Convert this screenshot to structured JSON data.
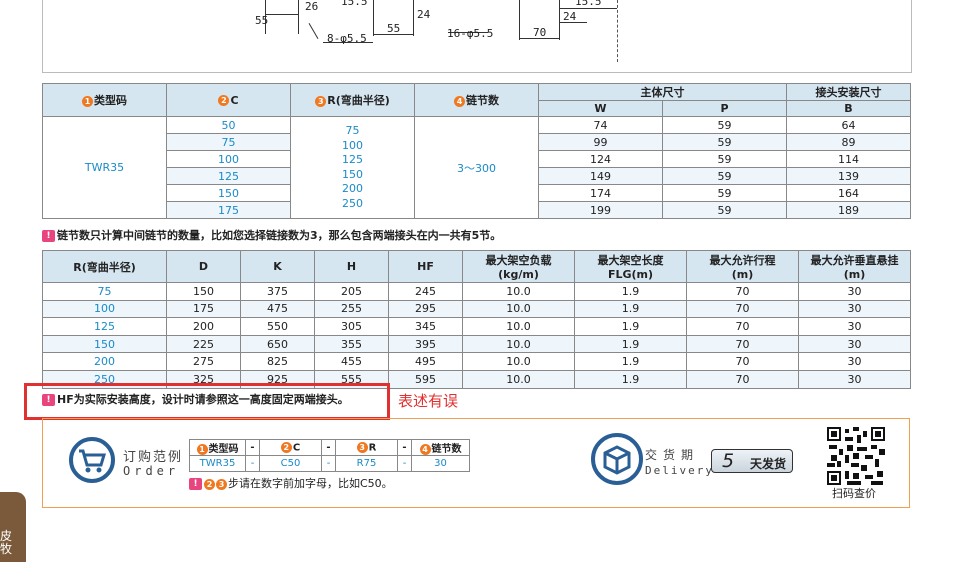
{
  "drawing": {
    "dims": [
      "15.5",
      "26",
      "55",
      "8-φ5.5",
      "24",
      "55",
      "16-φ5.5",
      "70",
      "15.5",
      "24"
    ]
  },
  "table1": {
    "headers": {
      "type_code": "类型码",
      "c": "C",
      "r": "R(弯曲半径)",
      "links": "链节数",
      "body_size": "主体尺寸",
      "joint_size": "接头安装尺寸",
      "w": "W",
      "p": "P",
      "b": "B"
    },
    "badges": [
      "1",
      "2",
      "3",
      "4"
    ],
    "type_code": "TWR35",
    "c_values": [
      "50",
      "75",
      "100",
      "125",
      "150",
      "175"
    ],
    "r_values": [
      "75",
      "100",
      "125",
      "150",
      "200",
      "250"
    ],
    "links": "3～300",
    "rows": [
      {
        "w": "74",
        "p": "59",
        "b": "64"
      },
      {
        "w": "99",
        "p": "59",
        "b": "89"
      },
      {
        "w": "124",
        "p": "59",
        "b": "114"
      },
      {
        "w": "149",
        "p": "59",
        "b": "139"
      },
      {
        "w": "174",
        "p": "59",
        "b": "164"
      },
      {
        "w": "199",
        "p": "59",
        "b": "189"
      }
    ]
  },
  "note1": "链节数只计算中间链节的数量，比如您选择链接数为3，那么包含两端接头在内一共有5节。",
  "table2": {
    "headers": [
      "R(弯曲半径)",
      "D",
      "K",
      "H",
      "HF",
      "最大架空负载",
      "最大架空长度",
      "最大允许行程",
      "最大允许垂直悬挂"
    ],
    "subheaders": [
      "(kg/m)",
      "FLG(m)",
      "(m)",
      "(m)"
    ],
    "rows": [
      [
        "75",
        "150",
        "375",
        "205",
        "245",
        "10.0",
        "1.9",
        "70",
        "30"
      ],
      [
        "100",
        "175",
        "475",
        "255",
        "295",
        "10.0",
        "1.9",
        "70",
        "30"
      ],
      [
        "125",
        "200",
        "550",
        "305",
        "345",
        "10.0",
        "1.9",
        "70",
        "30"
      ],
      [
        "150",
        "225",
        "650",
        "355",
        "395",
        "10.0",
        "1.9",
        "70",
        "30"
      ],
      [
        "200",
        "275",
        "825",
        "455",
        "495",
        "10.0",
        "1.9",
        "70",
        "30"
      ],
      [
        "250",
        "325",
        "925",
        "555",
        "595",
        "10.0",
        "1.9",
        "70",
        "30"
      ]
    ]
  },
  "note2": "HF为实际安装高度，设计时请参照这一高度固定两端接头。",
  "annotation": "表述有误",
  "order": {
    "title_cn": "订购范例",
    "title_en": "Order",
    "headers": [
      "类型码",
      "-",
      "C",
      "-",
      "R",
      "-",
      "链节数"
    ],
    "values": [
      "TWR35",
      "-",
      "C50",
      "-",
      "R75",
      "-",
      "30"
    ],
    "note": "步请在数字前加字母，比如C50。",
    "delivery_cn": "交货期",
    "delivery_en": "Delivery",
    "delivery_days": "5",
    "delivery_label": "天发货",
    "qr_label": "扫码查价"
  },
  "side_tab": "皮牧",
  "colors": {
    "accent": "#1a8bc8",
    "header_bg": "#d6e6f1",
    "badge": "#f07820",
    "warn": "#e8457f",
    "highlight": "#e03030",
    "order_border": "#f0a050"
  }
}
